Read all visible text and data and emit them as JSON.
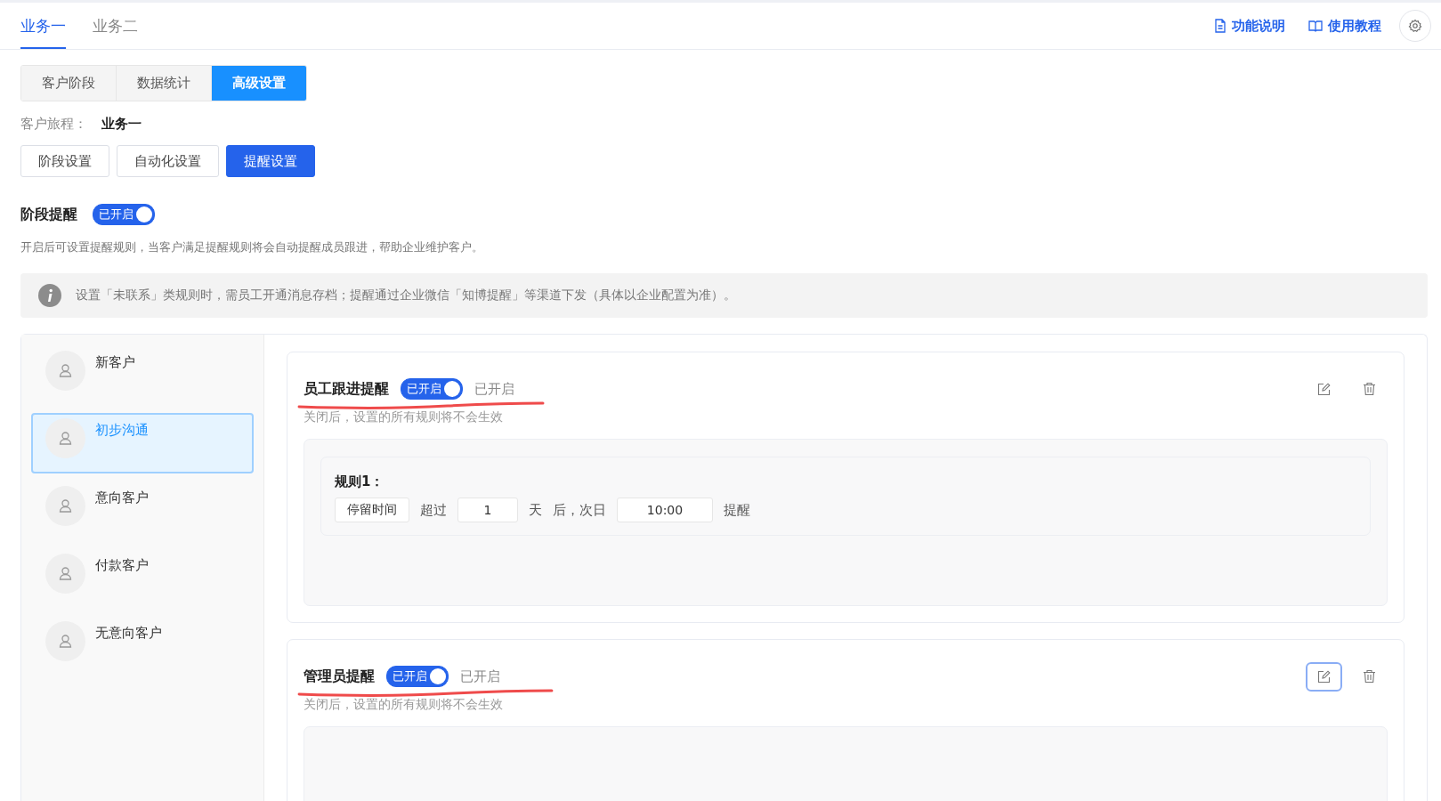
{
  "top_tabs": [
    {
      "label": "业务一",
      "selected": true
    },
    {
      "label": "业务二",
      "selected": false
    }
  ],
  "header_links": [
    {
      "label": "功能说明",
      "kind": "doc"
    },
    {
      "label": "使用教程",
      "kind": "book"
    }
  ],
  "view_tabs": [
    {
      "label": "客户阶段",
      "selected": false
    },
    {
      "label": "数据统计",
      "selected": false
    },
    {
      "label": "高级设置",
      "selected": true
    }
  ],
  "journey": {
    "label": "客户旅程：",
    "value": "业务一"
  },
  "settings_tabs": [
    {
      "label": "阶段设置",
      "selected": false
    },
    {
      "label": "自动化设置",
      "selected": false
    },
    {
      "label": "提醒设置",
      "selected": true
    }
  ],
  "stage_reminder": {
    "title": "阶段提醒",
    "on": true,
    "toggle_label": "已开启",
    "description": "开启后可设置提醒规则，当客户满足提醒规则将会自动提醒成员跟进，帮助企业维护客户。",
    "notice": "设置「未联系」类规则时，需员工开通消息存档；提醒通过企业微信「知博提醒」等渠道下发（具体以企业配置为准）。"
  },
  "stages": [
    {
      "name": "新客户",
      "selected": false
    },
    {
      "name": "初步沟通",
      "selected": true
    },
    {
      "name": "意向客户",
      "selected": false
    },
    {
      "name": "付款客户",
      "selected": false
    },
    {
      "name": "无意向客户",
      "selected": false
    }
  ],
  "reminder_cards": [
    {
      "title": "员工跟进提醒",
      "on": true,
      "toggle_label": "已开启",
      "status": "已开启",
      "hint": "关闭后，设置的所有规则将不会生效",
      "edit_focused": false,
      "rules": [
        {
          "title": "规则1：",
          "condition": "停留时间",
          "exceeds": "超过",
          "days": "1",
          "unit": "天",
          "after": "后，次日",
          "time": "10:00",
          "action": "提醒"
        }
      ]
    },
    {
      "title": "管理员提醒",
      "on": true,
      "toggle_label": "已开启",
      "status": "已开启",
      "hint": "关闭后，设置的所有规则将不会生效",
      "edit_focused": true
    }
  ]
}
